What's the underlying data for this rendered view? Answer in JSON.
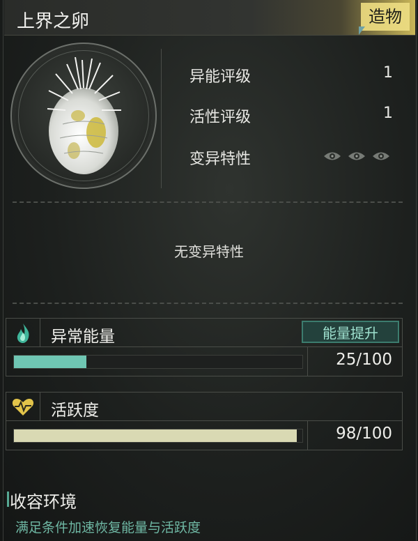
{
  "header": {
    "title": "上界之卵",
    "tag": "造物"
  },
  "item": {
    "portrait_icon": "feathered-egg"
  },
  "stats": [
    {
      "label": "异能评级",
      "value": "1"
    },
    {
      "label": "活性评级",
      "value": "1"
    },
    {
      "label": "变异特性",
      "value": "",
      "icons": [
        "eye-icon",
        "eye-icon",
        "eye-icon"
      ]
    }
  ],
  "mutation_note": "无变异特性",
  "energy": {
    "label": "异常能量",
    "button_label": "能量提升",
    "value_text": "25/100",
    "current": 25,
    "max": 100,
    "icon": "flame-icon",
    "color": "#6fc6b3"
  },
  "activity": {
    "label": "活跃度",
    "value_text": "98/100",
    "current": 98,
    "max": 100,
    "icon": "heart-pulse-icon",
    "color": "#d9d9b3"
  },
  "environment": {
    "title": "收容环境",
    "description": "满足条件加速恢复能量与活跃度"
  },
  "colors": {
    "accent_gold": "#e2d27a",
    "accent_teal": "#6fc6b3"
  }
}
